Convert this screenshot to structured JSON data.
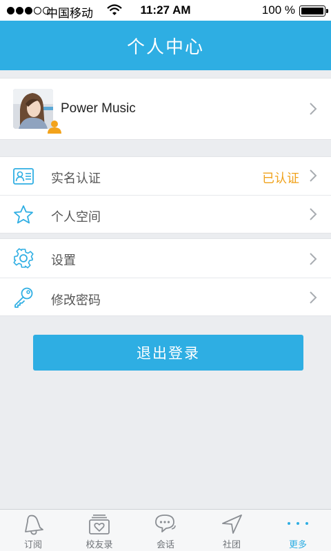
{
  "status_bar": {
    "carrier": "中国移动",
    "time": "11:27 AM",
    "battery": "100 %"
  },
  "nav": {
    "title": "个人中心"
  },
  "profile": {
    "name": "Power Music"
  },
  "account_group": [
    {
      "label": "实名认证",
      "value": "已认证",
      "icon": "id-card-icon"
    },
    {
      "label": "个人空间",
      "value": "",
      "icon": "star-icon"
    }
  ],
  "settings_group": [
    {
      "label": "设置",
      "icon": "gear-icon"
    },
    {
      "label": "修改密码",
      "icon": "key-icon"
    }
  ],
  "logout": {
    "label": "退出登录"
  },
  "tabs": [
    {
      "label": "订阅",
      "icon": "bell-icon"
    },
    {
      "label": "校友录",
      "icon": "yearbook-heart-icon"
    },
    {
      "label": "会话",
      "icon": "chat-bubbles-icon"
    },
    {
      "label": "社团",
      "icon": "navigation-arrow-icon"
    },
    {
      "label": "更多",
      "icon": "more-dots-icon",
      "active": true
    }
  ],
  "colors": {
    "accent": "#2eaee3",
    "verified": "#f0a21b",
    "background": "#ebedf0"
  }
}
